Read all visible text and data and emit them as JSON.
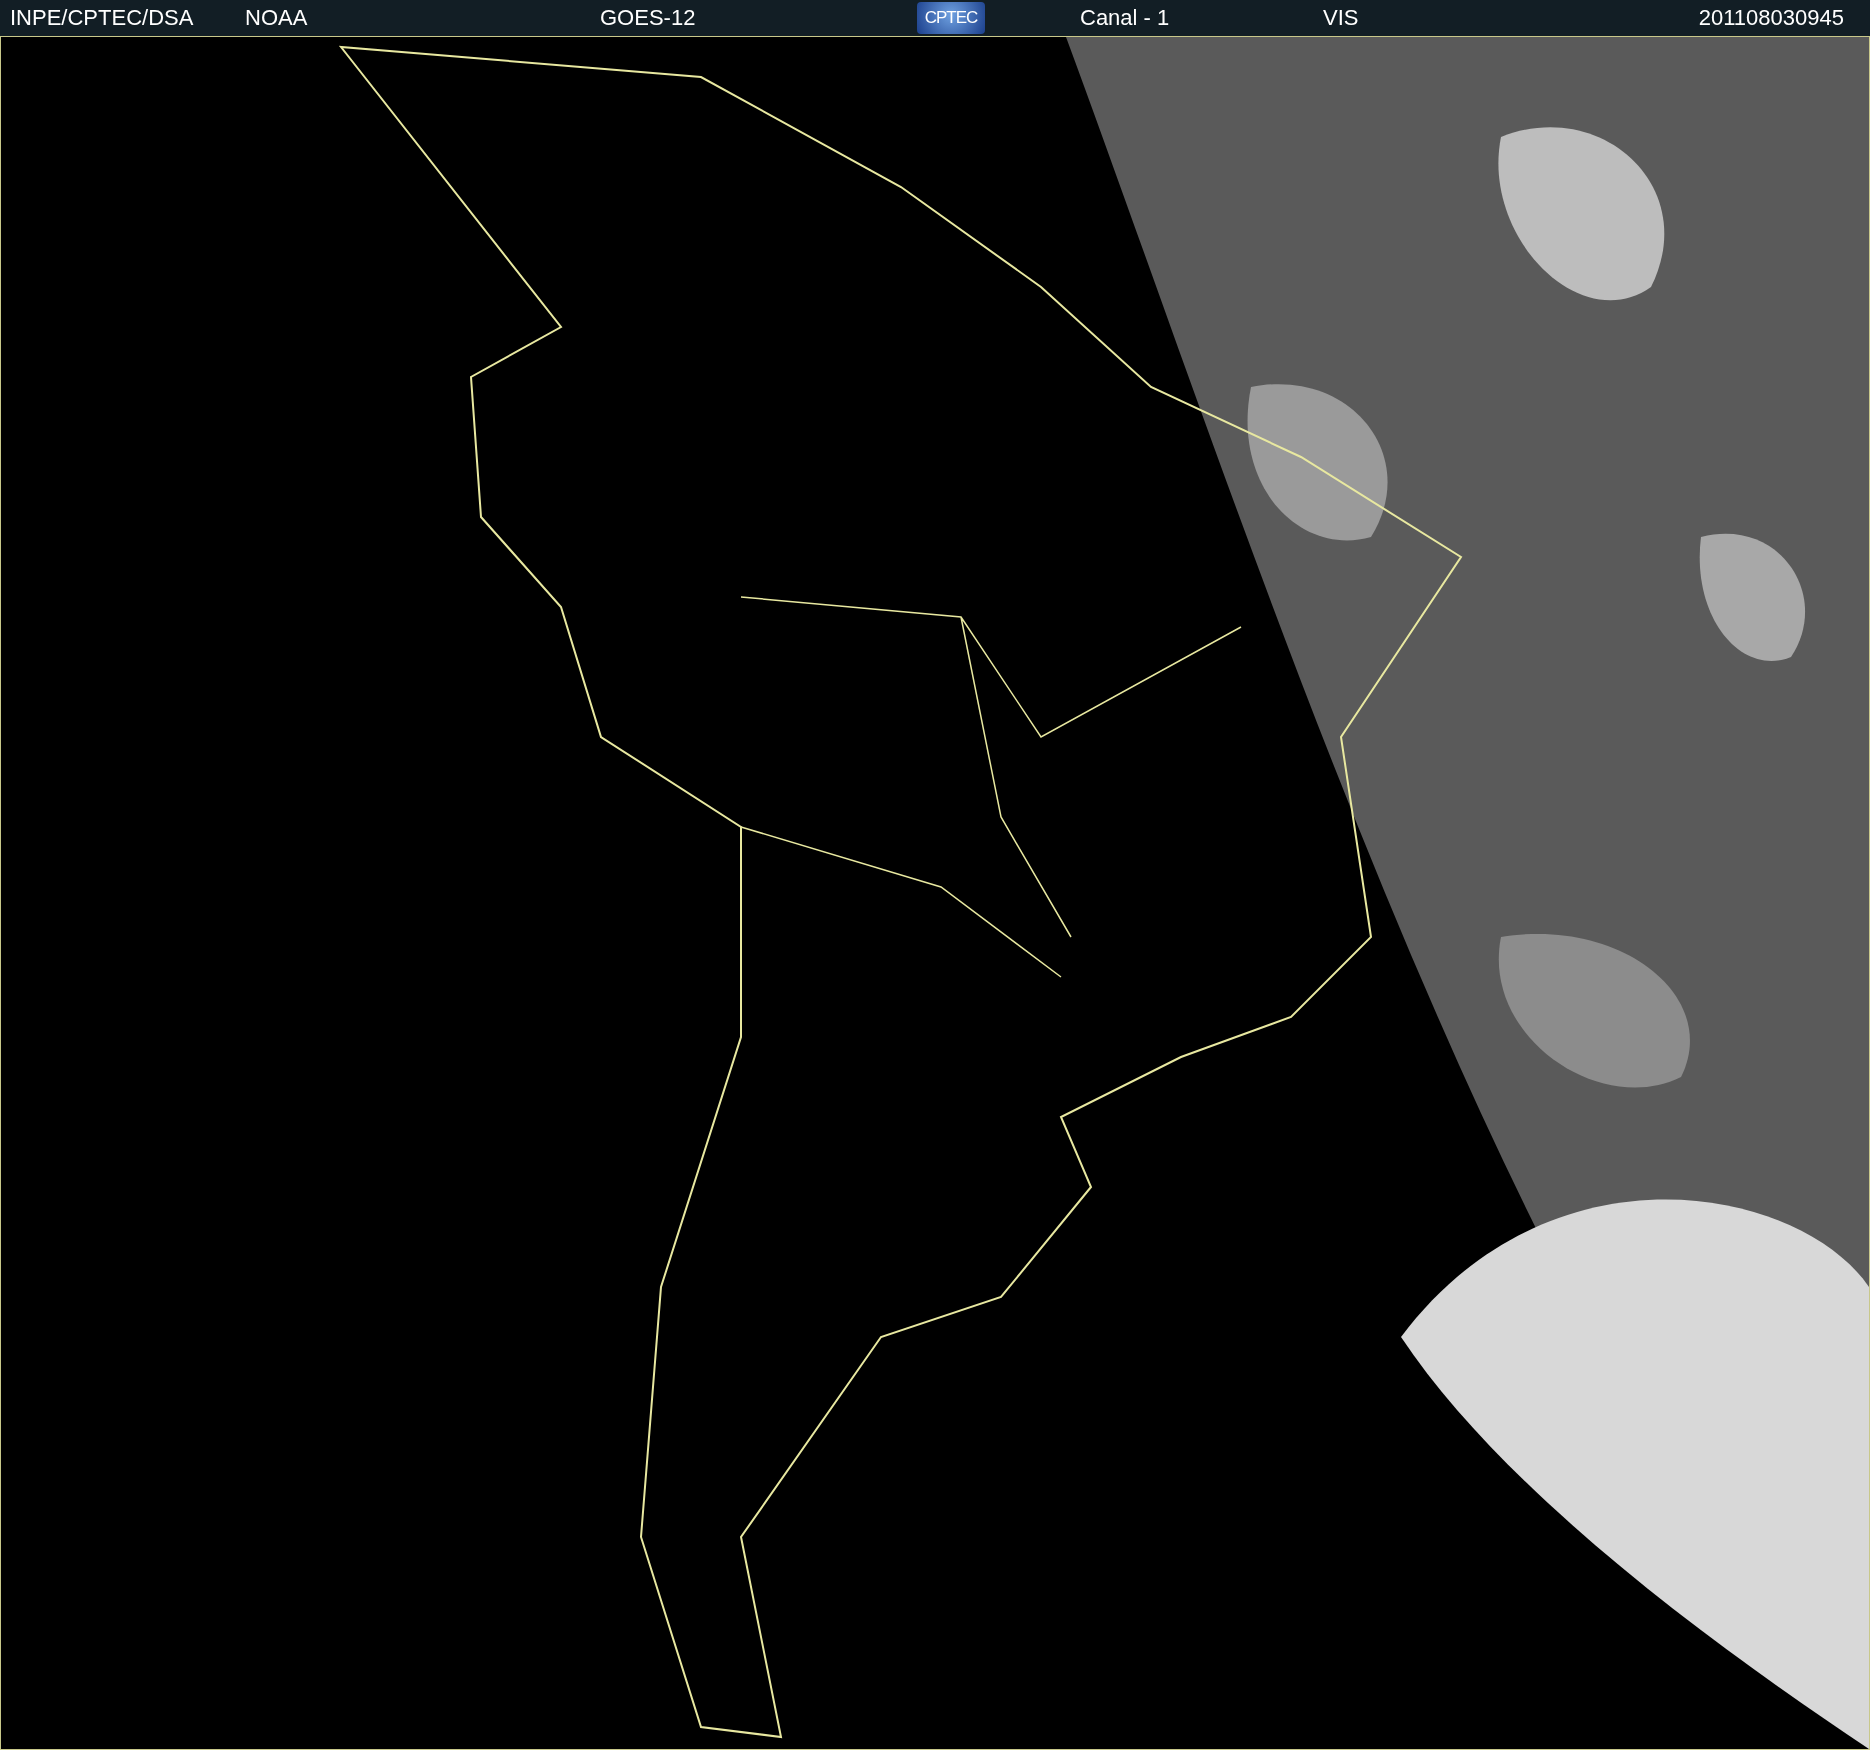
{
  "header": {
    "items": [
      {
        "kind": "text",
        "text": "INPE/CPTEC/DSA"
      },
      {
        "kind": "text",
        "text": "NOAA"
      },
      {
        "kind": "text",
        "text": "GOES-12"
      },
      {
        "kind": "logo",
        "text": "CPTEC"
      },
      {
        "kind": "text",
        "text": "Canal - 1"
      },
      {
        "kind": "text",
        "text": "VIS"
      },
      {
        "kind": "text",
        "text": "201108030945"
      }
    ]
  }
}
